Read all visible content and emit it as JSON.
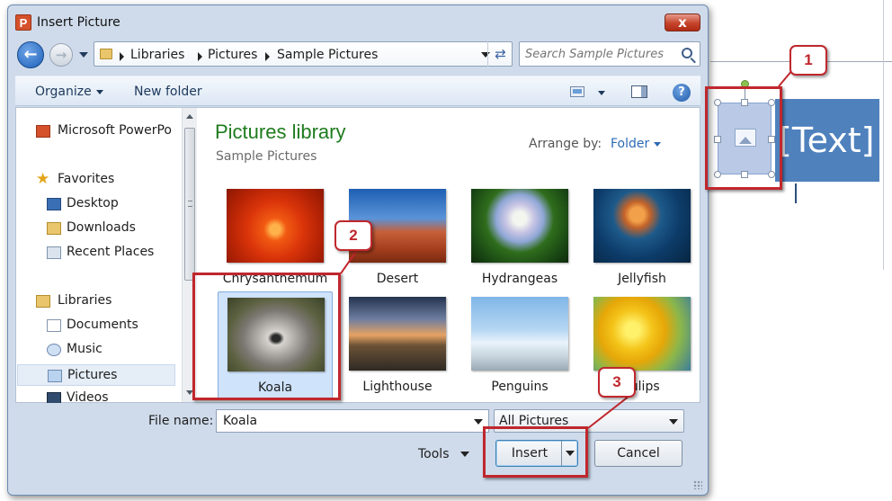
{
  "window": {
    "title": "Insert Picture",
    "app_icon": "P",
    "close_label": "x"
  },
  "address": {
    "crumbs": [
      "Libraries",
      "Pictures",
      "Sample Pictures"
    ],
    "search_placeholder": "Search Sample Pictures"
  },
  "toolbar": {
    "organize_label": "Organize",
    "new_folder_label": "New folder",
    "help_label": "?"
  },
  "nav": {
    "items": [
      {
        "label": "Microsoft PowerPo"
      },
      {
        "label": "Favorites"
      },
      {
        "label": "Desktop"
      },
      {
        "label": "Downloads"
      },
      {
        "label": "Recent Places"
      },
      {
        "label": "Libraries"
      },
      {
        "label": "Documents"
      },
      {
        "label": "Music"
      },
      {
        "label": "Pictures"
      },
      {
        "label": "Videos"
      }
    ]
  },
  "library": {
    "title": "Pictures library",
    "subtitle": "Sample Pictures",
    "arrange_label": "Arrange by:",
    "arrange_value": "Folder"
  },
  "files": [
    {
      "name": "Chrysanthemum"
    },
    {
      "name": "Desert"
    },
    {
      "name": "Hydrangeas"
    },
    {
      "name": "Jellyfish"
    },
    {
      "name": "Koala",
      "selected": true
    },
    {
      "name": "Lighthouse"
    },
    {
      "name": "Penguins"
    },
    {
      "name": "Tulips"
    }
  ],
  "footer": {
    "file_name_label": "File name:",
    "file_name_value": "Koala",
    "filter_value": "All Pictures",
    "tools_label": "Tools",
    "insert_label": "Insert",
    "cancel_label": "Cancel"
  },
  "slide": {
    "placeholder_text": "[Text]"
  },
  "callouts": [
    "1",
    "2",
    "3"
  ],
  "colors": {
    "callout_red": "#c0272d",
    "library_title_green": "#1e7b1e",
    "slide_box_blue": "#4f81bd"
  }
}
